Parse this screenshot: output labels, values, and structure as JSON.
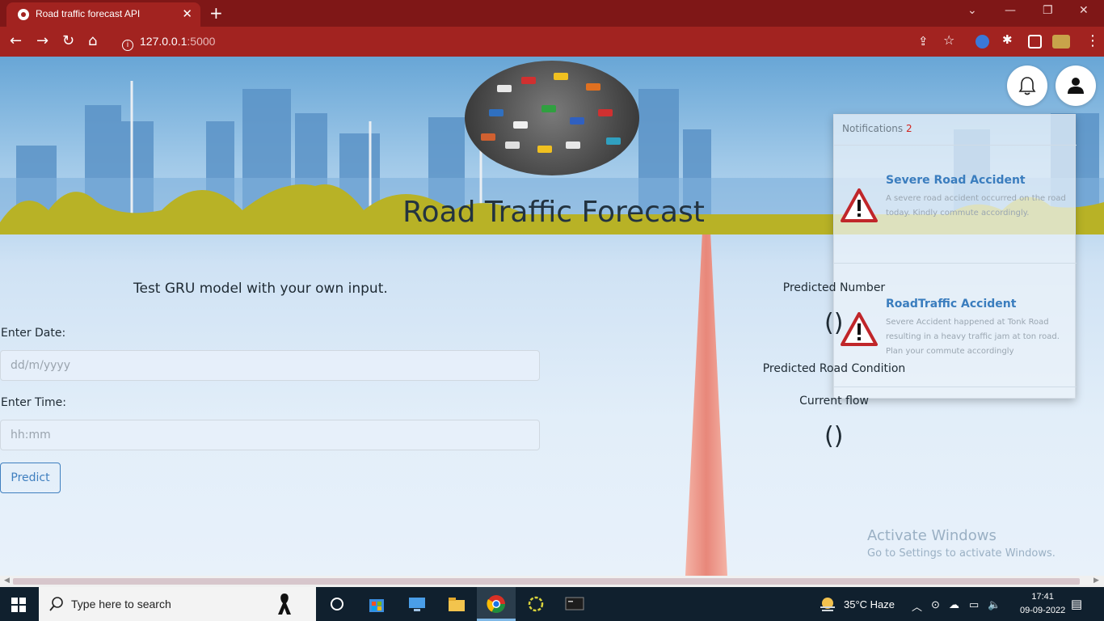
{
  "browser": {
    "tab_title": "Road traffic forecast API",
    "tab_close": "✕",
    "new_tab": "+",
    "url_host": "127.0.0.1",
    "url_port": ":5000",
    "window": {
      "minimize": "—",
      "maximize": "❐",
      "close": "✕",
      "tabsearch": "⌄"
    }
  },
  "hero": {
    "title": "Road Traffic Forecast"
  },
  "notifications": {
    "header": "Notifications",
    "count": "2",
    "items": [
      {
        "title": "Severe Road Accident",
        "body": "A severe road accident occurred on the road today. Kindly commute accordingly."
      },
      {
        "title": "RoadTraffic Accident",
        "body": "Severe Accident happened at Tonk Road resulting in a heavy traffic jam at ton road. Plan your commute accordingly"
      }
    ]
  },
  "form": {
    "heading": "Test GRU model with your own input.",
    "date_label": "Enter Date:",
    "date_placeholder": "dd/m/yyyy",
    "time_label": "Enter Time:",
    "time_placeholder": "hh:mm",
    "predict_label": "Predict"
  },
  "results": {
    "predicted_number_label": "Predicted Number",
    "predicted_number_value": "()",
    "predicted_condition_label": "Predicted Road Condition",
    "current_flow_label": "Current flow",
    "current_flow_value": "()"
  },
  "watermark": {
    "line1": "Activate Windows",
    "line2": "Go to Settings to activate Windows."
  },
  "taskbar": {
    "search_placeholder": "Type here to search",
    "weather": "35°C  Haze",
    "time": "17:41",
    "date": "09-09-2022"
  },
  "colors": {
    "tabbar": "#7f1717",
    "toolbar": "#a22320",
    "accent": "#3f7fbf",
    "badge": "#d2221c",
    "taskbar": "#10202e"
  }
}
